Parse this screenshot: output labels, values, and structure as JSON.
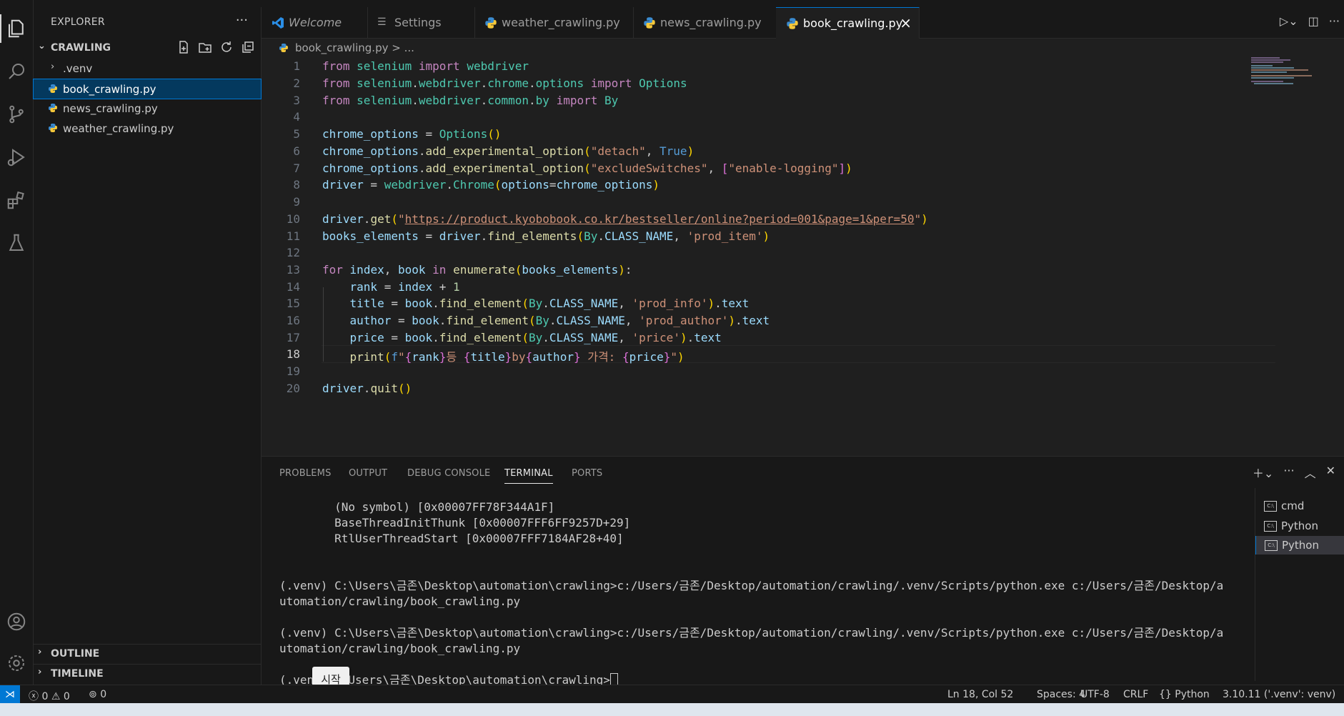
{
  "explorer": {
    "header": "EXPLORER",
    "more": "···",
    "folder": "CRAWLING",
    "items": [
      {
        "label": ".venv",
        "type": "folder"
      },
      {
        "label": "book_crawling.py",
        "type": "file",
        "selected": true
      },
      {
        "label": "news_crawling.py",
        "type": "file"
      },
      {
        "label": "weather_crawling.py",
        "type": "file"
      }
    ],
    "outline": "OUTLINE",
    "timeline": "TIMELINE"
  },
  "tabs": [
    {
      "label": "Welcome",
      "icon": "vscode-icon"
    },
    {
      "label": "Settings",
      "icon": "settings-lines-icon"
    },
    {
      "label": "weather_crawling.py",
      "icon": "python-icon"
    },
    {
      "label": "news_crawling.py",
      "icon": "python-icon"
    },
    {
      "label": "book_crawling.py",
      "icon": "python-icon",
      "active": true
    }
  ],
  "breadcrumb": "book_crawling.py > ...",
  "editor": {
    "line_numbers": [
      "1",
      "2",
      "3",
      "4",
      "5",
      "6",
      "7",
      "8",
      "9",
      "10",
      "11",
      "12",
      "13",
      "14",
      "15",
      "16",
      "17",
      "18",
      "19",
      "20"
    ],
    "current_line": "18"
  },
  "panel": {
    "tabs": [
      "PROBLEMS",
      "OUTPUT",
      "DEBUG CONSOLE",
      "TERMINAL",
      "PORTS"
    ],
    "active_tab": "TERMINAL",
    "terminal_lines": [
      "        (No symbol) [0x00007FF78F344A1F]",
      "        BaseThreadInitThunk [0x00007FFF6FF9257D+29]",
      "        RtlUserThreadStart [0x00007FFF7184AF28+40]",
      "",
      "",
      "(.venv) C:\\Users\\금존\\Desktop\\automation\\crawling>c:/Users/금존/Desktop/automation/crawling/.venv/Scripts/python.exe c:/Users/금존/Desktop/a",
      "utomation/crawling/book_crawling.py",
      "",
      "(.venv) C:\\Users\\금존\\Desktop\\automation\\crawling>c:/Users/금존/Desktop/automation/crawling/.venv/Scripts/python.exe c:/Users/금존/Desktop/a",
      "utomation/crawling/book_crawling.py",
      "",
      "(.ven     Users\\금존\\Desktop\\automation\\crawling>"
    ],
    "terminals": [
      {
        "label": "cmd"
      },
      {
        "label": "Python"
      },
      {
        "label": "Python",
        "selected": true
      }
    ],
    "tooltip": "시작"
  },
  "status": {
    "errors": "0",
    "warnings": "0",
    "ports": "0",
    "position": "Ln 18, Col 52",
    "spaces": "Spaces: 4",
    "encoding": "UTF-8",
    "eol": "CRLF",
    "language": "Python",
    "interpreter": "3.10.11 ('.venv': venv)"
  },
  "colors": {
    "accent": "#0078d4",
    "keyword": "#c586c0",
    "string": "#ce9178",
    "variable": "#9cdcfe",
    "function": "#dcdcaa",
    "class": "#4ec9b0"
  }
}
